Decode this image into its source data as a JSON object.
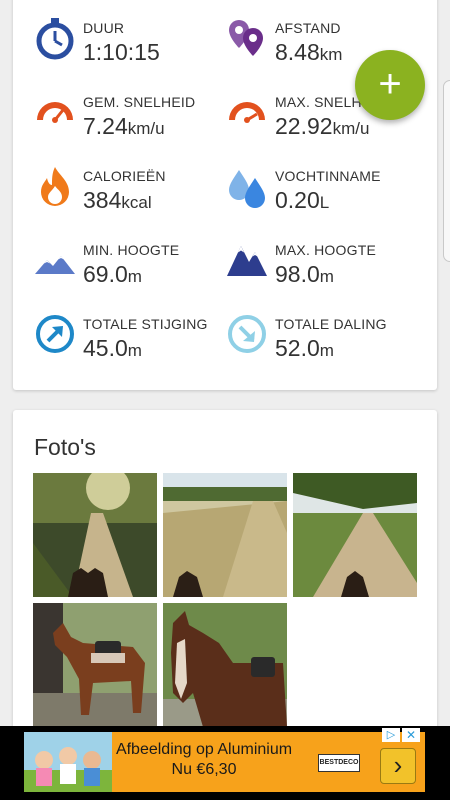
{
  "stats": {
    "duration": {
      "label": "DUUR",
      "value": "1:10:15",
      "unit": "",
      "icon": "stopwatch-icon"
    },
    "distance": {
      "label": "AFSTAND",
      "value": "8.48",
      "unit": "km",
      "icon": "location-pins-icon"
    },
    "avg_speed": {
      "label": "GEM. SNELHEID",
      "value": "7.24",
      "unit": "km/u",
      "icon": "speedometer-icon"
    },
    "max_speed": {
      "label": "MAX. SNELHEID",
      "value": "22.92",
      "unit": "km/u",
      "icon": "speedometer-icon"
    },
    "calories": {
      "label": "CALORIEËN",
      "value": "384",
      "unit": "kcal",
      "icon": "flame-icon"
    },
    "hydration": {
      "label": "VOCHTINNAME",
      "value": "0.20",
      "unit": "L",
      "icon": "water-drops-icon"
    },
    "min_altitude": {
      "label": "MIN. HOOGTE",
      "value": "69.0",
      "unit": "m",
      "icon": "mountains-light-icon"
    },
    "max_altitude": {
      "label": "MAX. HOOGTE",
      "value": "98.0",
      "unit": "m",
      "icon": "mountains-dark-icon"
    },
    "total_ascent": {
      "label": "TOTALE STIJGING",
      "value": "45.0",
      "unit": "m",
      "icon": "arrow-up-circle-icon"
    },
    "total_descent": {
      "label": "TOTALE DALING",
      "value": "52.0",
      "unit": "m",
      "icon": "arrow-down-circle-icon"
    }
  },
  "photos": {
    "title": "Foto's",
    "items": [
      "forest-path-photo",
      "sandy-trail-photo",
      "tree-lined-road-photo",
      "horse-saddled-photo",
      "horse-portrait-photo"
    ]
  },
  "fab": {
    "label": "+"
  },
  "ad": {
    "text": "Afbeelding op Aluminium Nu €6,30",
    "brand": "BESTDECO",
    "arrow": "›",
    "choices": "▷",
    "close": "✕"
  },
  "colors": {
    "accent": "#8bb220",
    "ad_bg": "#f7a21b"
  }
}
